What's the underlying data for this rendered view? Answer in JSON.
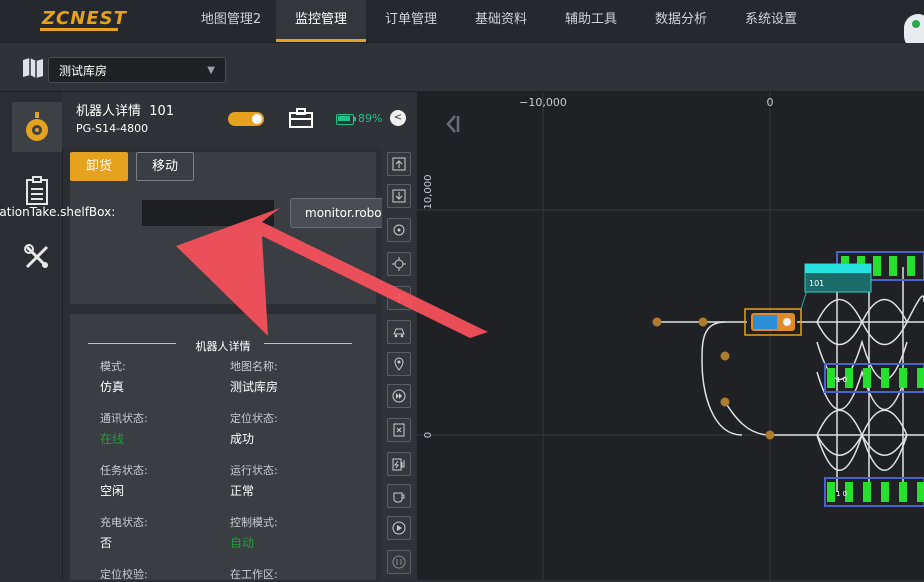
{
  "app": {
    "logo": "ZCNEST"
  },
  "nav": [
    {
      "label": "地图管理2"
    },
    {
      "label": "监控管理",
      "active": true
    },
    {
      "label": "订单管理"
    },
    {
      "label": "基础资料"
    },
    {
      "label": "辅助工具"
    },
    {
      "label": "数据分析"
    },
    {
      "label": "系统设置"
    }
  ],
  "warehouse_select": {
    "value": "测试库房"
  },
  "robot": {
    "title": "机器人详情",
    "id": "101",
    "code": "PG-S14-4800",
    "battery": "89%"
  },
  "actions": {
    "unload": "卸货",
    "move": "移动"
  },
  "field": {
    "label": "OperationTake.shelfBox:",
    "value": ""
  },
  "tooltip": {
    "text": "monitor.robot"
  },
  "details": {
    "section_title": "机器人详情",
    "items": [
      {
        "key": "模式:",
        "value": "仿真"
      },
      {
        "key": "地图名称:",
        "value": "测试库房"
      },
      {
        "key": "通讯状态:",
        "value": "在线",
        "status": "green"
      },
      {
        "key": "定位状态:",
        "value": "成功"
      },
      {
        "key": "任务状态:",
        "value": "空闲"
      },
      {
        "key": "运行状态:",
        "value": "正常"
      },
      {
        "key": "充电状态:",
        "value": "否"
      },
      {
        "key": "控制模式:",
        "value": "自动",
        "status": "green"
      },
      {
        "key": "定位校验:",
        "value": ""
      },
      {
        "key": "在工作区:",
        "value": ""
      }
    ]
  },
  "map": {
    "x_ticks": [
      "−10,000",
      "0"
    ],
    "y_ticks": [
      "10,000",
      "0"
    ],
    "robot_label": "101",
    "shelf_label": "1 0"
  },
  "colors": {
    "accent": "#e6a11e",
    "online": "#1f9d3a",
    "battery": "#1cc38a",
    "annotation_arrow": "#f4505c"
  }
}
